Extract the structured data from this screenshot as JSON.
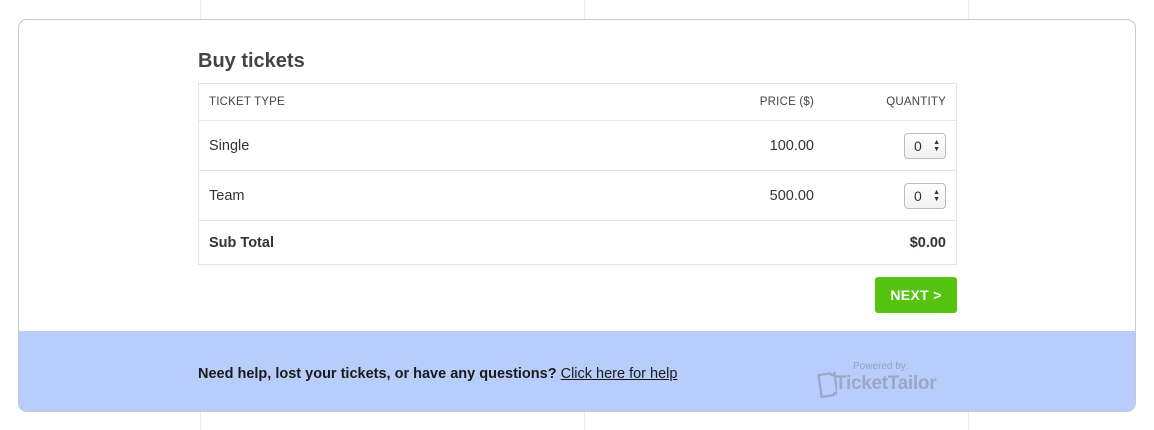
{
  "page": {
    "title": "Buy tickets"
  },
  "table": {
    "headers": {
      "type": "TICKET TYPE",
      "price": "PRICE ($)",
      "quantity": "QUANTITY"
    },
    "rows": [
      {
        "type": "Single",
        "price": "100.00",
        "quantity": "0"
      },
      {
        "type": "Team",
        "price": "500.00",
        "quantity": "0"
      }
    ],
    "subtotal_label": "Sub Total",
    "subtotal_value": "$0.00"
  },
  "actions": {
    "next_label": "NEXT >"
  },
  "footer": {
    "help_text": "Need help, lost your tickets, or have any questions? ",
    "help_link": "Click here for help",
    "powered_by": "Powered by:",
    "brand": "TicketTailor"
  },
  "colors": {
    "next_button": "#56c30f",
    "footer_background": "#b8cdfb",
    "brand_logo": "#9aa8c4"
  },
  "icons": {
    "quantity_arrows": "up-down-arrows-icon",
    "brand_logo": "ticket-icon"
  }
}
